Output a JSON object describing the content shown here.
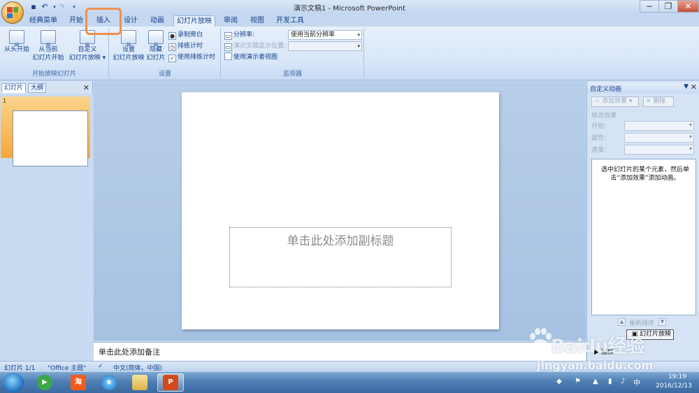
{
  "window": {
    "title": "演示文稿1 - Microsoft PowerPoint",
    "minimize": "−",
    "restore": "❐",
    "close": "✕"
  },
  "ribbon_tabs": [
    {
      "label": "经典菜单"
    },
    {
      "label": "开始"
    },
    {
      "label": "插入"
    },
    {
      "label": "设计"
    },
    {
      "label": "动画"
    },
    {
      "label": "幻灯片放映"
    },
    {
      "label": "审阅"
    },
    {
      "label": "视图"
    },
    {
      "label": "开发工具"
    }
  ],
  "ribbon": {
    "group_start_show": {
      "label": "开始放映幻灯片",
      "from_beginning": "从头开始",
      "from_current_1": "从当前",
      "from_current_2": "幻灯片开始",
      "custom_1": "自定义",
      "custom_2": "幻灯片放映 ▾"
    },
    "group_setup": {
      "label": "设置",
      "setup_1": "设置",
      "setup_2": "幻灯片放映",
      "hide_1": "隐藏",
      "hide_2": "幻灯片",
      "record_narration": "录制旁白",
      "rehearse_timings": "排练计时",
      "use_rehearsed_timings": "使用排练计时"
    },
    "group_monitors": {
      "label": "监视器",
      "resolution_label": "分辨率:",
      "resolution_value": "使用当前分辨率",
      "show_on_label": "演示文稿显示位置:",
      "presenter_view": "使用演示者视图"
    }
  },
  "left_panel": {
    "tab_slides": "幻灯片",
    "tab_outline": "大纲",
    "close": "✕",
    "slide_number": "1"
  },
  "slide": {
    "subtitle_placeholder": "单击此处添加副标题"
  },
  "notes": {
    "placeholder": "单击此处添加备注"
  },
  "task_pane": {
    "title": "自定义动画",
    "dropdown": "▼",
    "close": "✕",
    "add_effect": "添加效果 ▾",
    "remove": "删除",
    "modify_effect": "修改效果",
    "start_label": "开始:",
    "property_label": "属性:",
    "speed_label": "速度:",
    "hint": "选中幻灯片的某个元素，然后单击“添加效果”添加动画。",
    "reorder": "重新排序",
    "slideshow_button": "幻灯片放映",
    "preview": "播放"
  },
  "status_bar": {
    "slide_info": "幻灯片 1/1",
    "theme": "\"Office 主题\"",
    "language": "中文(简体，中国)"
  },
  "taskbar": {
    "taobao_label": "淘",
    "clock_time": "19:19",
    "clock_date": "2016/12/13",
    "ime": "中"
  },
  "watermark": {
    "text": "Baidu经验",
    "url": "jingyan.baidu.com"
  }
}
